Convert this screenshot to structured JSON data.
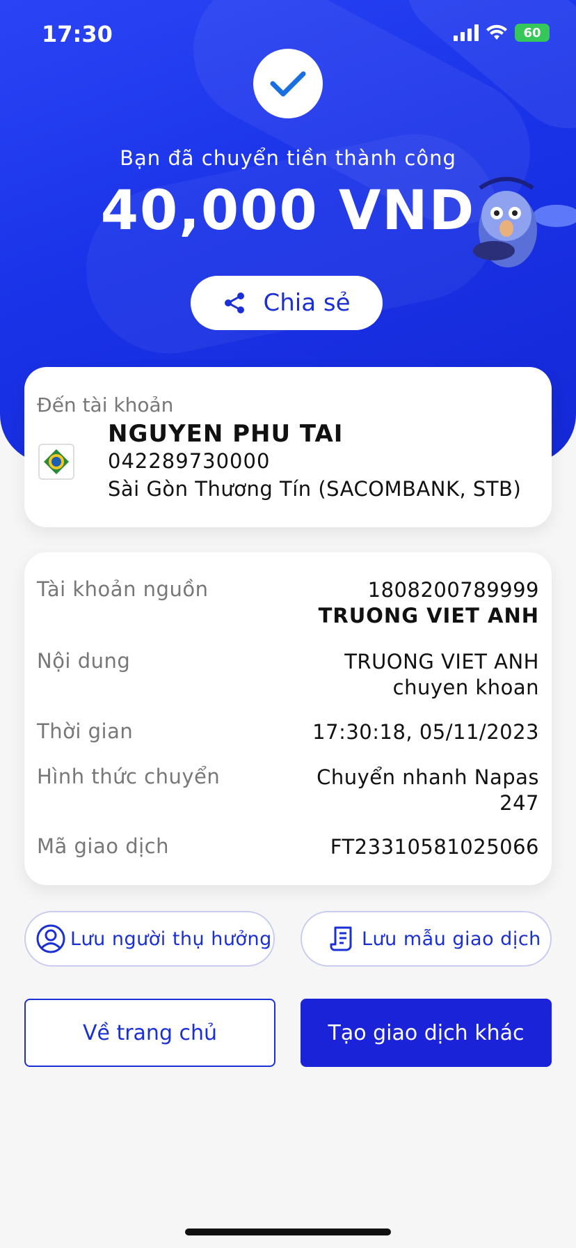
{
  "status_bar": {
    "time": "17:30",
    "battery": "60"
  },
  "hero": {
    "success_text": "Bạn đã chuyển tiền thành công",
    "amount": "40,000 VND",
    "share_label": "Chia sẻ"
  },
  "recipient": {
    "label": "Đến tài khoản",
    "name": "NGUYEN PHU TAI",
    "account": "042289730000",
    "bank": "Sài Gòn Thương Tín (SACOMBANK, STB)"
  },
  "details": {
    "source_label": "Tài khoản nguồn",
    "source_account": "1808200789999",
    "source_name": "TRUONG VIET ANH",
    "content_label": "Nội dung",
    "content_line1": "TRUONG VIET ANH",
    "content_line2": "chuyen khoan",
    "time_label": "Thời gian",
    "time_value": "17:30:18, 05/11/2023",
    "method_label": "Hình thức chuyển",
    "method_line1": "Chuyển nhanh Napas",
    "method_line2": "247",
    "txn_label": "Mã giao dịch",
    "txn_value": "FT23310581025066"
  },
  "actions": {
    "save_beneficiary": "Lưu người thụ hưởng",
    "save_template": "Lưu mẫu giao dịch",
    "home": "Về trang chủ",
    "new_transaction": "Tạo giao dịch khác"
  },
  "colors": {
    "primary": "#1a2fd6",
    "hero": "#1f38ee",
    "success_check": "#1a6fe0"
  }
}
